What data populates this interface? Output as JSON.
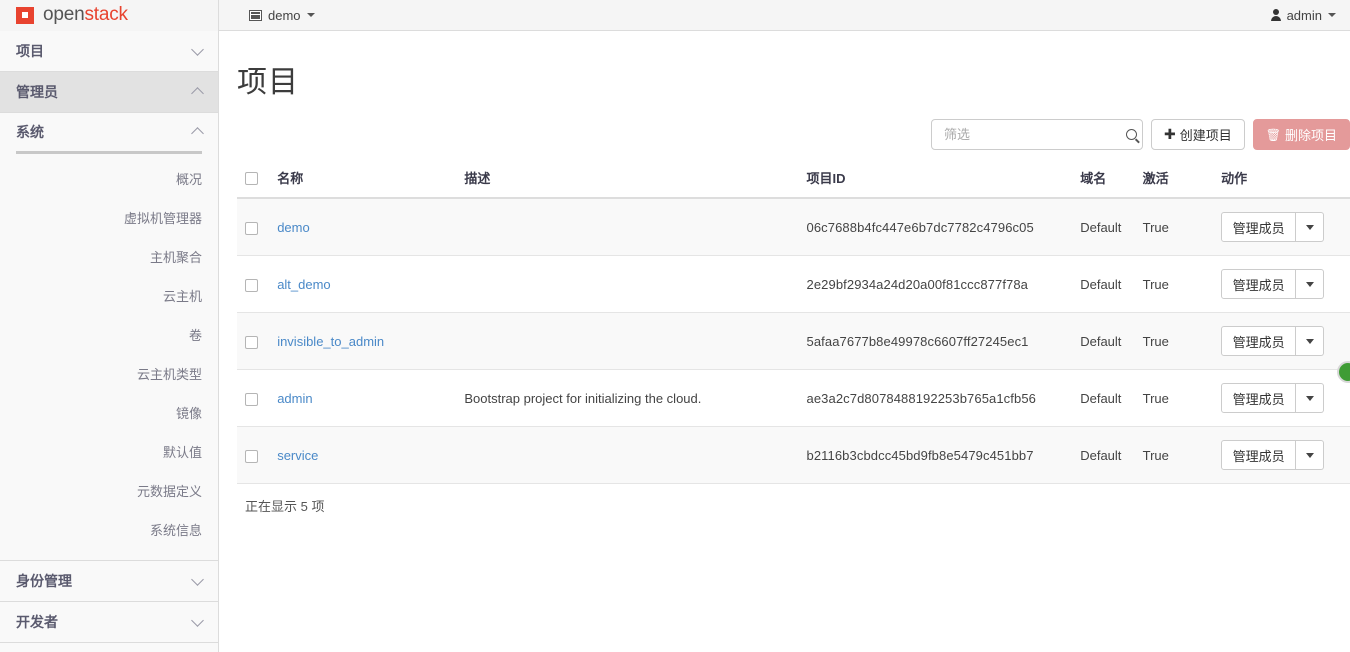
{
  "navbar": {
    "brand_open": "open",
    "brand_stack": "stack",
    "tenant_label": "demo",
    "tenant_icon": "list-icon",
    "user_label": "admin",
    "user_icon": "user-icon"
  },
  "sidebar": {
    "sections": [
      {
        "label": "项目",
        "state": "collapsed",
        "active": false
      },
      {
        "label": "管理员",
        "state": "expanded",
        "active": true
      }
    ],
    "system": {
      "label": "系统",
      "state": "expanded",
      "items": [
        {
          "label": "概况"
        },
        {
          "label": "虚拟机管理器"
        },
        {
          "label": "主机聚合"
        },
        {
          "label": "云主机"
        },
        {
          "label": "卷"
        },
        {
          "label": "云主机类型"
        },
        {
          "label": "镜像"
        },
        {
          "label": "默认值"
        },
        {
          "label": "元数据定义"
        },
        {
          "label": "系统信息"
        }
      ]
    },
    "bottom_sections": [
      {
        "label": "身份管理",
        "state": "collapsed"
      },
      {
        "label": "开发者",
        "state": "collapsed"
      }
    ]
  },
  "page": {
    "title": "项目"
  },
  "toolbar": {
    "search_placeholder": "筛选",
    "search_value": "",
    "search_icon": "search-icon",
    "create_label": "创建项目",
    "create_icon": "plus-icon",
    "delete_label": "删除项目",
    "delete_icon": "trash-icon",
    "delete_color": "#e49a9a"
  },
  "table": {
    "select_all_checkbox": "",
    "headers": {
      "name": "名称",
      "description": "描述",
      "project_id": "项目ID",
      "domain": "域名",
      "enabled": "激活",
      "actions": "动作"
    },
    "action_button_label": "管理成员",
    "rows": [
      {
        "name": "demo",
        "description": "",
        "project_id": "06c7688b4fc447e6b7dc7782c4796c05",
        "domain": "Default",
        "enabled": "True"
      },
      {
        "name": "alt_demo",
        "description": "",
        "project_id": "2e29bf2934a24d20a00f81ccc877f78a",
        "domain": "Default",
        "enabled": "True"
      },
      {
        "name": "invisible_to_admin",
        "description": "",
        "project_id": "5afaa7677b8e49978c6607ff27245ec1",
        "domain": "Default",
        "enabled": "True"
      },
      {
        "name": "admin",
        "description": "Bootstrap project for initializing the cloud.",
        "project_id": "ae3a2c7d8078488192253b765a1cfb56",
        "domain": "Default",
        "enabled": "True"
      },
      {
        "name": "service",
        "description": "",
        "project_id": "b2116b3cbdcc45bd9fb8e5479c451bb7",
        "domain": "Default",
        "enabled": "True"
      }
    ],
    "footer": "正在显示 5 项"
  }
}
